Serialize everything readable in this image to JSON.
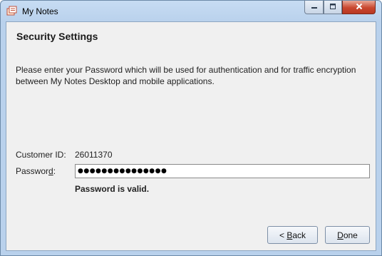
{
  "window": {
    "title": "My Notes",
    "app_icon": "notes-app-icon",
    "controls": {
      "minimize_icon": "minimize-icon",
      "maximize_icon": "maximize-icon",
      "close_icon": "close-icon"
    }
  },
  "page": {
    "heading": "Security Settings",
    "description": "Please enter your Password which will be used for authentication and for traffic encryption between My Notes Desktop and mobile applications."
  },
  "form": {
    "customer_id_label": "Customer ID:",
    "customer_id_value": "26011370",
    "password_label": "Password:",
    "password_value": "●●●●●●●●●●●●●●●",
    "password_status": "Password is valid."
  },
  "buttons": {
    "back_mnemonic": "B",
    "back_rest": "ack",
    "back_prefix": "< ",
    "done_mnemonic": "D",
    "done_rest": "one"
  },
  "colors": {
    "titlebar": "#b9d1ec",
    "client_bg": "#f0f0f0",
    "close_button": "#c9472f"
  }
}
